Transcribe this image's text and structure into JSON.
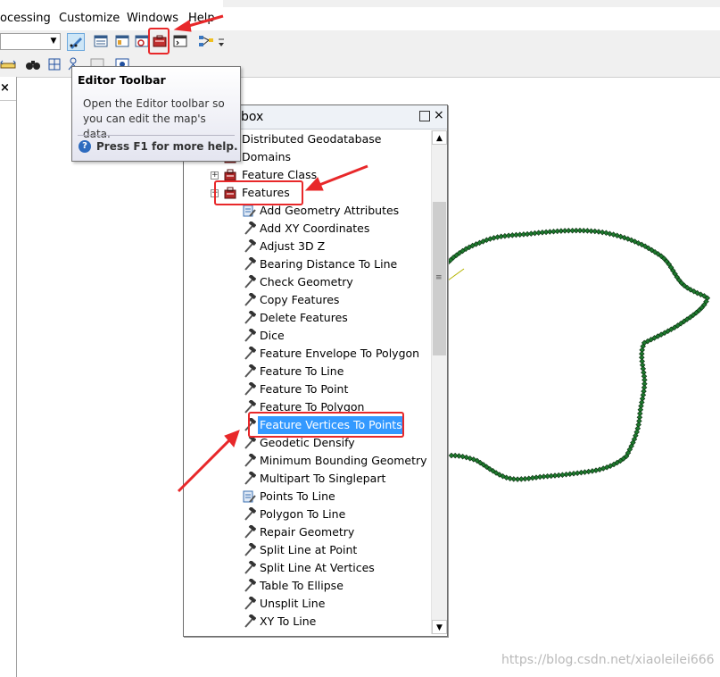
{
  "menubar": {
    "items": [
      {
        "label": "ocessing"
      },
      {
        "label": "Customize"
      },
      {
        "label": "Windows"
      },
      {
        "label": "Help"
      }
    ]
  },
  "tooltip": {
    "title": "Editor Toolbar",
    "body": "Open the Editor toolbar so you can edit the map's data.",
    "help": "Press F1 for more help."
  },
  "toolbox": {
    "title": "box",
    "items": [
      {
        "label": "Distributed Geodatabase",
        "level": 0,
        "icon": "toolset-icon",
        "expander": ""
      },
      {
        "label": "Domains",
        "level": 0,
        "icon": "toolset-icon",
        "expander": ""
      },
      {
        "label": "Feature Class",
        "level": 0,
        "icon": "toolset-icon",
        "expander": "+"
      },
      {
        "label": "Features",
        "level": 0,
        "icon": "toolset-icon",
        "expander": "-"
      },
      {
        "label": "Add Geometry Attributes",
        "level": 1,
        "icon": "script-tool-icon"
      },
      {
        "label": "Add XY Coordinates",
        "level": 1,
        "icon": "hammer-icon"
      },
      {
        "label": "Adjust 3D Z",
        "level": 1,
        "icon": "hammer-icon"
      },
      {
        "label": "Bearing Distance To Line",
        "level": 1,
        "icon": "hammer-icon"
      },
      {
        "label": "Check Geometry",
        "level": 1,
        "icon": "hammer-icon"
      },
      {
        "label": "Copy Features",
        "level": 1,
        "icon": "hammer-icon"
      },
      {
        "label": "Delete Features",
        "level": 1,
        "icon": "hammer-icon"
      },
      {
        "label": "Dice",
        "level": 1,
        "icon": "hammer-icon"
      },
      {
        "label": "Feature Envelope To Polygon",
        "level": 1,
        "icon": "hammer-icon"
      },
      {
        "label": "Feature To Line",
        "level": 1,
        "icon": "hammer-icon"
      },
      {
        "label": "Feature To Point",
        "level": 1,
        "icon": "hammer-icon"
      },
      {
        "label": "Feature To Polygon",
        "level": 1,
        "icon": "hammer-icon"
      },
      {
        "label": "Feature Vertices To Points",
        "level": 1,
        "icon": "hammer-icon",
        "selected": true
      },
      {
        "label": "Geodetic Densify",
        "level": 1,
        "icon": "hammer-icon"
      },
      {
        "label": "Minimum Bounding Geometry",
        "level": 1,
        "icon": "hammer-icon"
      },
      {
        "label": "Multipart To Singlepart",
        "level": 1,
        "icon": "hammer-icon"
      },
      {
        "label": "Points To Line",
        "level": 1,
        "icon": "script-tool-icon"
      },
      {
        "label": "Polygon To Line",
        "level": 1,
        "icon": "hammer-icon"
      },
      {
        "label": "Repair Geometry",
        "level": 1,
        "icon": "hammer-icon"
      },
      {
        "label": "Split Line at Point",
        "level": 1,
        "icon": "hammer-icon"
      },
      {
        "label": "Split Line At Vertices",
        "level": 1,
        "icon": "hammer-icon"
      },
      {
        "label": "Table To Ellipse",
        "level": 1,
        "icon": "hammer-icon"
      },
      {
        "label": "Unsplit Line",
        "level": 1,
        "icon": "hammer-icon"
      },
      {
        "label": "XY To Line",
        "level": 1,
        "icon": "hammer-icon"
      }
    ]
  },
  "watermark": "https://blog.csdn.net/xiaoleilei666",
  "colors": {
    "highlight": "#e8282a",
    "selection": "#3399ff",
    "point-fill": "#1e7a2e"
  }
}
